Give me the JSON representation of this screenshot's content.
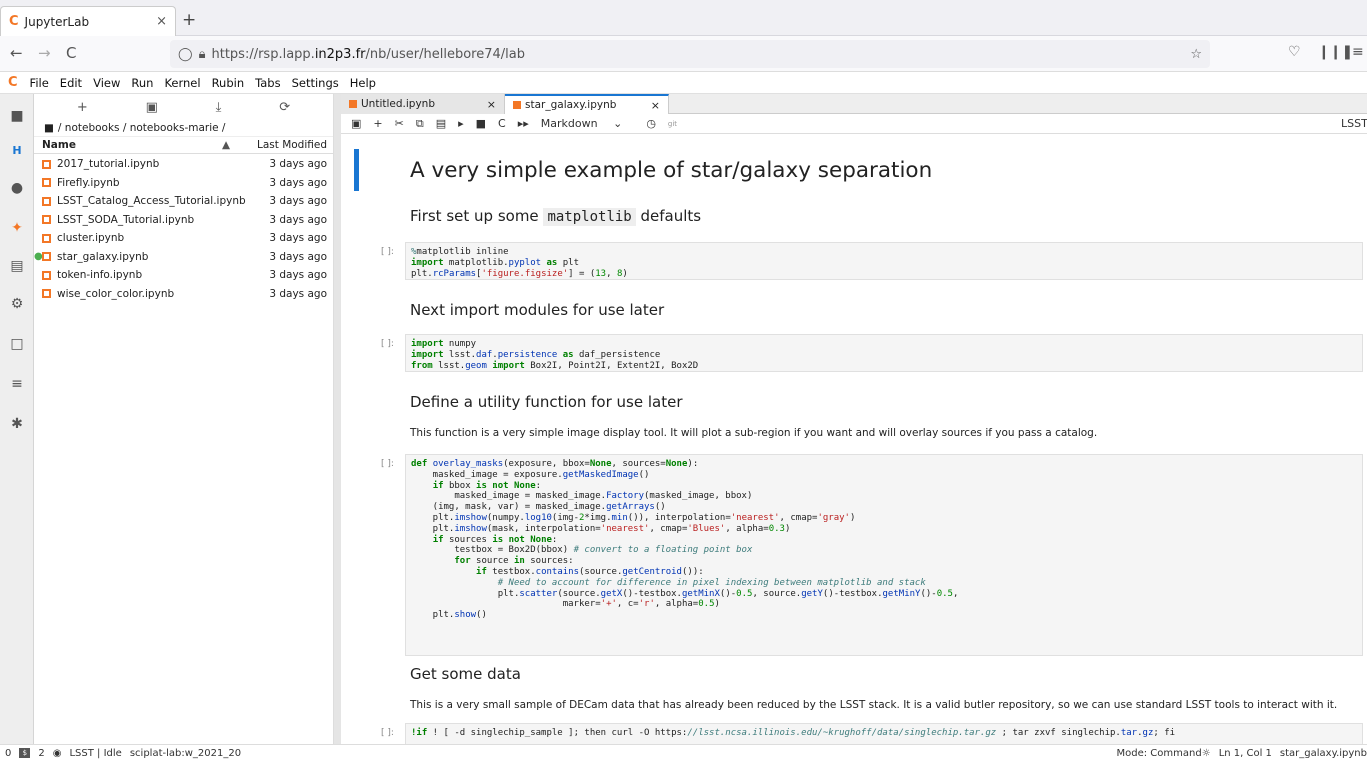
{
  "browser": {
    "tab_title": "JupyterLab",
    "tab_close": "×",
    "new_tab": "+",
    "url_prefix": "https://rsp.lapp.",
    "url_host": "in2p3.fr",
    "url_path": "/nb/user/hellebore74/lab",
    "back": "←",
    "forward": "→",
    "reload": "C"
  },
  "menu": [
    "File",
    "Edit",
    "View",
    "Run",
    "Kernel",
    "Rubin",
    "Tabs",
    "Settings",
    "Help"
  ],
  "filebrowser": {
    "breadcrumb": "/ notebooks / notebooks-marie /",
    "col_name": "Name",
    "col_modified": "Last Modified",
    "files": [
      {
        "name": "2017_tutorial.ipynb",
        "modified": "3 days ago"
      },
      {
        "name": "Firefly.ipynb",
        "modified": "3 days ago"
      },
      {
        "name": "LSST_Catalog_Access_Tutorial.ipynb",
        "modified": "3 days ago"
      },
      {
        "name": "LSST_SODA_Tutorial.ipynb",
        "modified": "3 days ago"
      },
      {
        "name": "cluster.ipynb",
        "modified": "3 days ago"
      },
      {
        "name": "star_galaxy.ipynb",
        "modified": "3 days ago"
      },
      {
        "name": "token-info.ipynb",
        "modified": "3 days ago"
      },
      {
        "name": "wise_color_color.ipynb",
        "modified": "3 days ago"
      }
    ]
  },
  "notebook": {
    "tabs": [
      "Untitled.ipynb",
      "star_galaxy.ipynb"
    ],
    "cell_type": "Markdown",
    "git": "git",
    "kernel": "LSST (",
    "h1": "A very simple example of star/galaxy separation",
    "h2_1_pre": "First set up some ",
    "h2_1_code": "matplotlib",
    "h2_1_post": " defaults",
    "h2_2": "Next import modules for use later",
    "h2_3": "Define a utility function for use later",
    "p_3": "This function is a very simple image display tool. It will plot a sub-region if you want and will overlay sources if you pass a catalog.",
    "h2_4": "Get some data",
    "p_4": "This is a very small sample of DECam data that has already been reduced by the LSST stack. It is a valid butler repository, so we can use standard LSST tools to interact with it.",
    "prompt": "[ ]:"
  },
  "status": {
    "count1": "0",
    "count2": "2",
    "kernel_state": "LSST | Idle",
    "env": "sciplat-lab:w_2021_20",
    "mode": "Mode: Command",
    "position": "Ln 1, Col 1",
    "file": "star_galaxy.ipynb"
  }
}
